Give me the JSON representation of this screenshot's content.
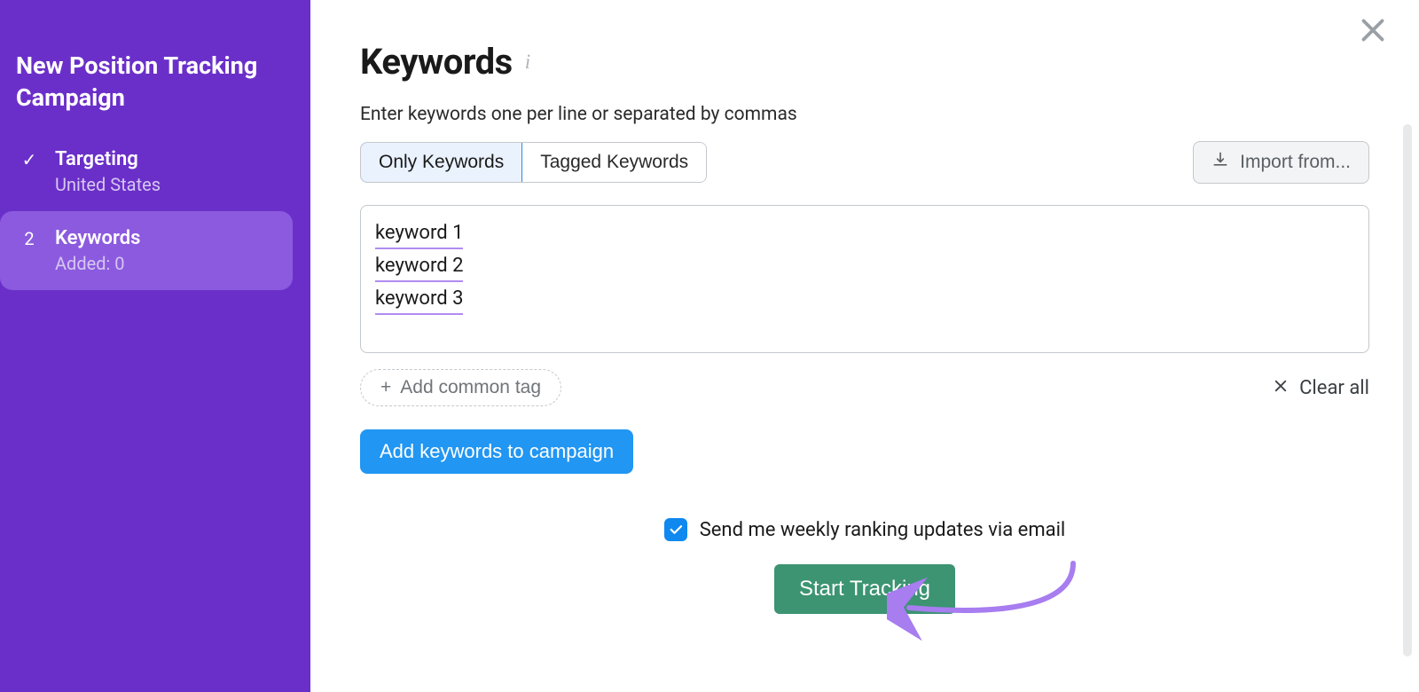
{
  "sidebar": {
    "title": "New Position Tracking Campaign",
    "steps": [
      {
        "icon": "✓",
        "title": "Targeting",
        "sub": "United States"
      },
      {
        "icon": "2",
        "title": "Keywords",
        "sub": "Added: 0"
      }
    ]
  },
  "main": {
    "title": "Keywords",
    "hint": "Enter keywords one per line or separated by commas",
    "tabs": {
      "only": "Only Keywords",
      "tagged": "Tagged Keywords"
    },
    "import_label": "Import from...",
    "keywords": [
      "keyword 1",
      "keyword 2",
      "keyword 3"
    ],
    "add_tag_label": "Add common tag",
    "clear_label": "Clear all",
    "add_keywords_btn": "Add keywords to campaign",
    "checkbox_label": "Send me weekly ranking updates via email",
    "start_btn": "Start Tracking"
  }
}
